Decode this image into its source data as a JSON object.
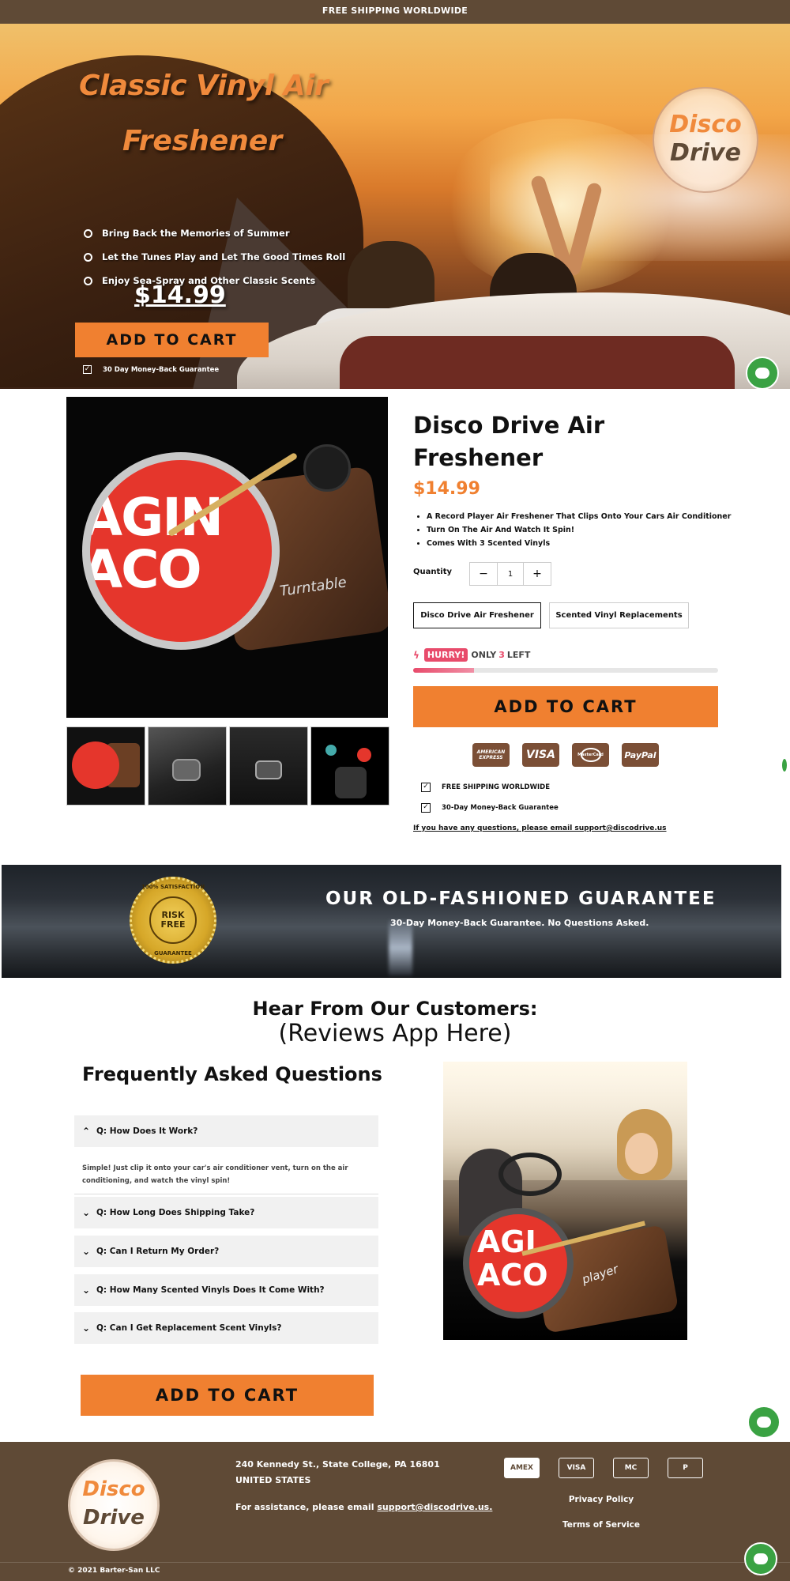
{
  "announcement": "FREE SHIPPING WORLDWIDE",
  "hero": {
    "title_line1": "Classic Vinyl Air",
    "title_line2": "Freshener",
    "logo_word1": "Disco",
    "logo_word2": "Drive",
    "bullets": [
      "Bring Back the Memories of Summer",
      "Let the Tunes Play and Let The Good Times Roll",
      "Enjoy Sea-Spray and Other Classic Scents"
    ],
    "price": "$14.99",
    "add_to_cart": "ADD TO CART",
    "guarantee": "30 Day Money-Back Guarantee"
  },
  "product": {
    "image_text": "AGIN\nACO",
    "turntable_label": "Turntable",
    "title": "Disco Drive Air Freshener",
    "price": "$14.99",
    "bullets": [
      "A Record Player Air Freshener That Clips Onto Your Cars Air Conditioner",
      "Turn On The Air And Watch It Spin!",
      "Comes With 3 Scented Vinyls"
    ],
    "quantity_label": "Quantity",
    "quantity_value": "1",
    "quantity_minus": "−",
    "quantity_plus": "+",
    "variants": [
      "Disco Drive Air Freshener",
      "Scented Vinyl Replacements"
    ],
    "hurry": {
      "icon": "lightning-icon",
      "badge": "HURRY!",
      "prefix": "ONLY",
      "count": "3",
      "suffix": "LEFT",
      "stock_fraction": 0.2
    },
    "add_to_cart": "ADD TO CART",
    "payment_cards": [
      "AMERICAN EXPRESS",
      "VISA",
      "MasterCard",
      "PayPal"
    ],
    "features": [
      "FREE SHIPPING WORLDWIDE",
      "30-Day Money-Back Guarantee"
    ],
    "contact": "If you have any questions, please email support@discodrive.us"
  },
  "guarantee_banner": {
    "seal_top": "100% SATISFACTION",
    "seal_center1": "RISK",
    "seal_center2": "FREE",
    "seal_bottom": "GUARANTEE",
    "title": "OUR OLD-FASHIONED GUARANTEE",
    "subtitle": "30-Day Money-Back Guarantee. No Questions Asked."
  },
  "reviews": {
    "title": "Hear From Our Customers:",
    "subtitle": "(Reviews App Here)"
  },
  "faq": {
    "title": "Frequently Asked Questions",
    "items": [
      {
        "q": "Q: How Does It Work?",
        "open": true
      },
      {
        "q": "Q: How Long Does Shipping Take?",
        "open": false
      },
      {
        "q": "Q: Can I Return My Order?",
        "open": false
      },
      {
        "q": "Q: How Many Scented Vinyls Does It Come With?",
        "open": false
      },
      {
        "q": "Q: Can I Get Replacement Scent Vinyls?",
        "open": false
      }
    ],
    "answer": "Simple! Just clip it onto your car's air conditioner vent, turn on the air conditioning, and watch the vinyl spin!",
    "image_disc_text": "AGI\nACO",
    "image_base_label": "player",
    "add_to_cart": "ADD TO CART"
  },
  "footer": {
    "logo_word1": "Disco",
    "logo_word2": "Drive",
    "address_line1": "240 Kennedy St., State College, PA 16801",
    "address_line2": "UNITED STATES",
    "assist_prefix": "For assistance, please email",
    "assist_email": "support@discodrive.us.",
    "payment_cards": [
      "AMEX",
      "VISA",
      "MC",
      "P"
    ],
    "privacy": "Privacy Policy",
    "terms": "Terms of Service",
    "copyright": "© 2021 Barter-San LLC"
  },
  "colors": {
    "brown": "#5f4a36",
    "orange": "#f08030",
    "hurry_pink": "#e84b6b",
    "chat_green": "#3aa243"
  }
}
